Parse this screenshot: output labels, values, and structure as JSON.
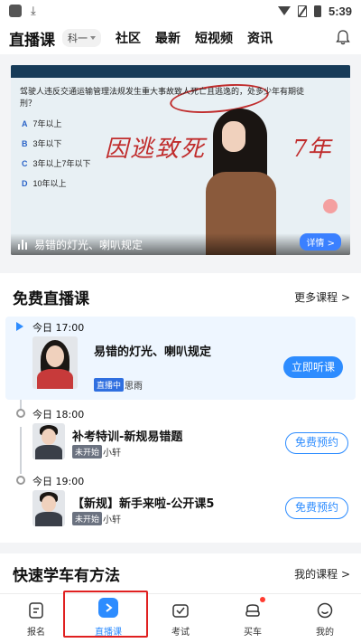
{
  "status_bar": {
    "time": "5:39"
  },
  "top_nav": {
    "title": "直播课",
    "subject": "科一",
    "tabs": [
      "社区",
      "最新",
      "短视频",
      "资讯"
    ]
  },
  "video": {
    "question": "驾驶人违反交通运输管理法规发生重大事故致人死亡且逃逸的，处多少年有期徒刑？",
    "options": [
      {
        "letter": "A",
        "text": "7年以上"
      },
      {
        "letter": "B",
        "text": "3年以下"
      },
      {
        "letter": "C",
        "text": "3年以上7年以下"
      },
      {
        "letter": "D",
        "text": "10年以上"
      }
    ],
    "handwriting_left": "因逃致死",
    "handwriting_right": "7年",
    "title": "易错的灯光、喇叭规定",
    "detail_button": "详情 >"
  },
  "free_live": {
    "title": "免费直播课",
    "more": "更多课程 >",
    "items": [
      {
        "time": "今日 17:00",
        "title": "易错的灯光、喇叭规定",
        "status": "直播中",
        "teacher": "思雨",
        "button": "立即听课"
      },
      {
        "time": "今日 18:00",
        "title": "补考特训-新规易错题",
        "status": "未开始",
        "teacher": "小轩",
        "button": "免费预约"
      },
      {
        "time": "今日 19:00",
        "title": "【新规】新手来啦-公开课5",
        "status": "未开始",
        "teacher": "小轩",
        "button": "免费预约"
      }
    ]
  },
  "quick_learn": {
    "title": "快速学车有方法",
    "link": "我的课程 >"
  },
  "tabbar": {
    "tabs": [
      {
        "label": "报名",
        "icon": "signup-icon"
      },
      {
        "label": "直播课",
        "icon": "live-play-icon"
      },
      {
        "label": "考试",
        "icon": "exam-icon"
      },
      {
        "label": "买车",
        "icon": "car-icon"
      },
      {
        "label": "我的",
        "icon": "profile-icon"
      }
    ],
    "active_index": 1
  },
  "colors": {
    "accent": "#2d8cff",
    "highlight_box": "#e02020",
    "notification_dot": "#ff3b30"
  }
}
